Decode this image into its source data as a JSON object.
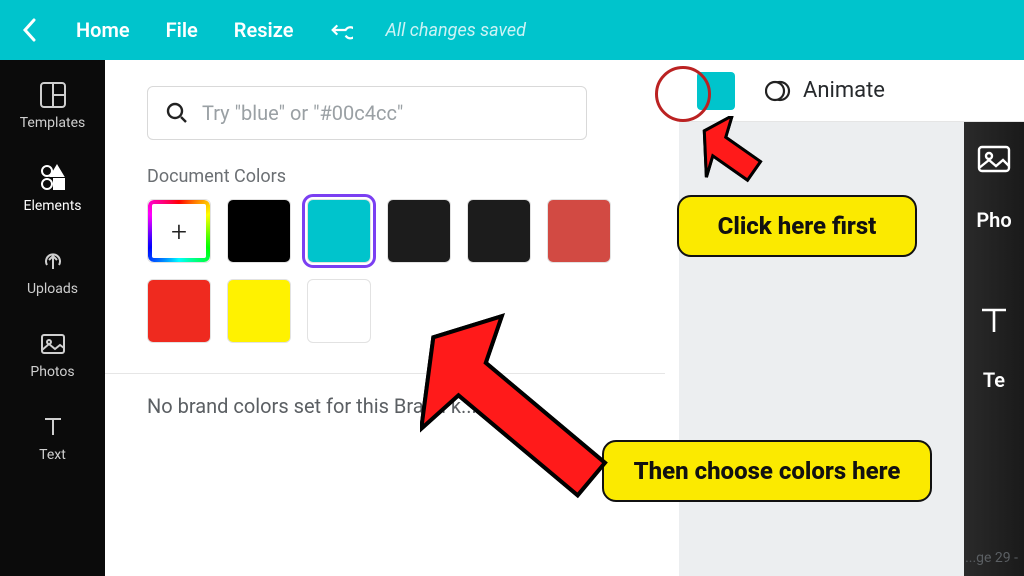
{
  "topbar": {
    "home": "Home",
    "file": "File",
    "resize": "Resize",
    "status": "All changes saved"
  },
  "sidebar": {
    "items": [
      {
        "label": "Templates"
      },
      {
        "label": "Elements"
      },
      {
        "label": "Uploads"
      },
      {
        "label": "Photos"
      },
      {
        "label": "Text"
      }
    ]
  },
  "panel": {
    "search_placeholder": "Try \"blue\" or \"#00c4cc\"",
    "doc_colors_title": "Document Colors",
    "brand_msg": "No brand colors set for this Brand k...",
    "colors": {
      "c1": "#000000",
      "c2": "#00c4cc",
      "c3": "#1c1c1c",
      "c4": "#1c1c1c",
      "c5": "#d24a43",
      "c6": "#ef2a1f",
      "c7": "#fff200",
      "c8": "#ffffff"
    }
  },
  "toolbar": {
    "animate": "Animate",
    "current_color": "#00c4cc"
  },
  "canvas": {
    "photos_tab": "Pho",
    "text_tab": "Te",
    "page_label": "...ge 29 -"
  },
  "callouts": {
    "c1": "Click here first",
    "c2": "Then choose colors here"
  }
}
